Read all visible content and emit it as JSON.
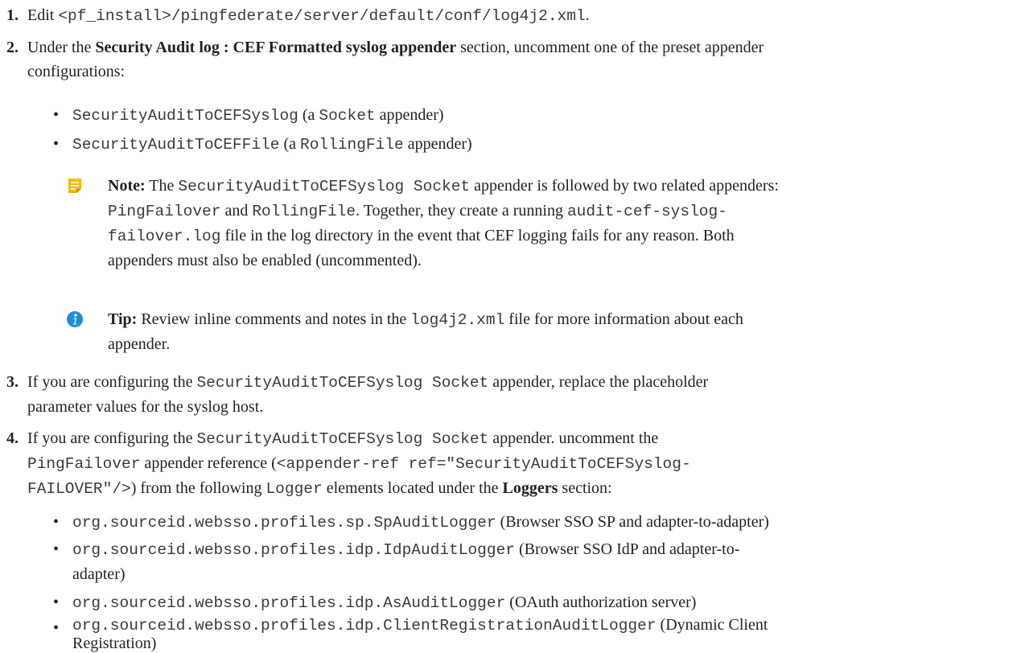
{
  "steps": [
    {
      "number": "1.",
      "text_a": "Edit ",
      "code_a": "<pf_install>/pingfederate/server/default/conf/log4j2.xml",
      "text_b": "."
    },
    {
      "number": "2.",
      "text_a": "Under the ",
      "bold_a": "Security Audit log : CEF Formatted syslog appender",
      "text_b": " section, uncomment one of the preset appender",
      "text_c": "configurations:",
      "bullets": [
        {
          "code_a": "SecurityAuditToCEFSyslog",
          "text_a": " (a ",
          "code_b": "Socket",
          "text_b": " appender)"
        },
        {
          "code_a": "SecurityAuditToCEFFile",
          "text_a": " (a ",
          "code_b": "RollingFile",
          "text_b": " appender)"
        }
      ],
      "note": {
        "label": "Note:",
        "text_a": " The ",
        "code_a": "SecurityAuditToCEFSyslog Socket",
        "text_b": " appender is followed by two related appenders:",
        "code_b": "PingFailover",
        "text_c": " and ",
        "code_c": "RollingFile",
        "text_d": ". Together, they create a running ",
        "code_d": "audit-cef-syslog-",
        "code_e": "failover.log",
        "text_e": " file in the log directory in the event that CEF logging fails for any reason. Both",
        "text_f": "appenders must also be enabled (uncommented)."
      },
      "tip": {
        "label": "Tip:",
        "text_a": " Review inline comments and notes in the ",
        "code_a": "log4j2.xml",
        "text_b": " file for more information about each",
        "text_c": "appender."
      }
    },
    {
      "number": "3.",
      "text_a": "If you are configuring the ",
      "code_a": "SecurityAuditToCEFSyslog Socket",
      "text_b": " appender, replace the placeholder",
      "text_c": "parameter values for the syslog host."
    },
    {
      "number": "4.",
      "text_a": "If you are configuring the ",
      "code_a": "SecurityAuditToCEFSyslog Socket",
      "text_b": " appender. uncomment the",
      "code_b": "PingFailover",
      "text_c": " appender reference (",
      "code_c": "<appender-ref ref=\"SecurityAuditToCEFSyslog-",
      "code_d": "FAILOVER\"/>",
      "text_d": ") from the following ",
      "code_e": "Logger",
      "text_e": " elements located under the ",
      "bold_a": "Loggers",
      "text_f": " section:",
      "bullets": [
        {
          "code_a": "org.sourceid.websso.profiles.sp.SpAuditLogger",
          "text_a": " (Browser SSO SP and adapter-to-adapter)"
        },
        {
          "code_a": "org.sourceid.websso.profiles.idp.IdpAuditLogger",
          "text_a": " (Browser SSO IdP and adapter-to-",
          "text_b": "adapter)"
        },
        {
          "code_a": "org.sourceid.websso.profiles.idp.AsAuditLogger",
          "text_a": " (OAuth authorization server)"
        },
        {
          "code_a": "org.sourceid.websso.profiles.idp.ClientRegistrationAuditLogger",
          "text_a": " (Dynamic Client",
          "text_b": "Registration)"
        }
      ]
    }
  ],
  "bullet_glyph": "•",
  "icons": {
    "note": "note-icon",
    "tip": "info-icon"
  },
  "colors": {
    "note_icon": "#f0b400",
    "tip_icon": "#1e8fd6",
    "text": "#222222",
    "code": "#3a3a3a"
  }
}
